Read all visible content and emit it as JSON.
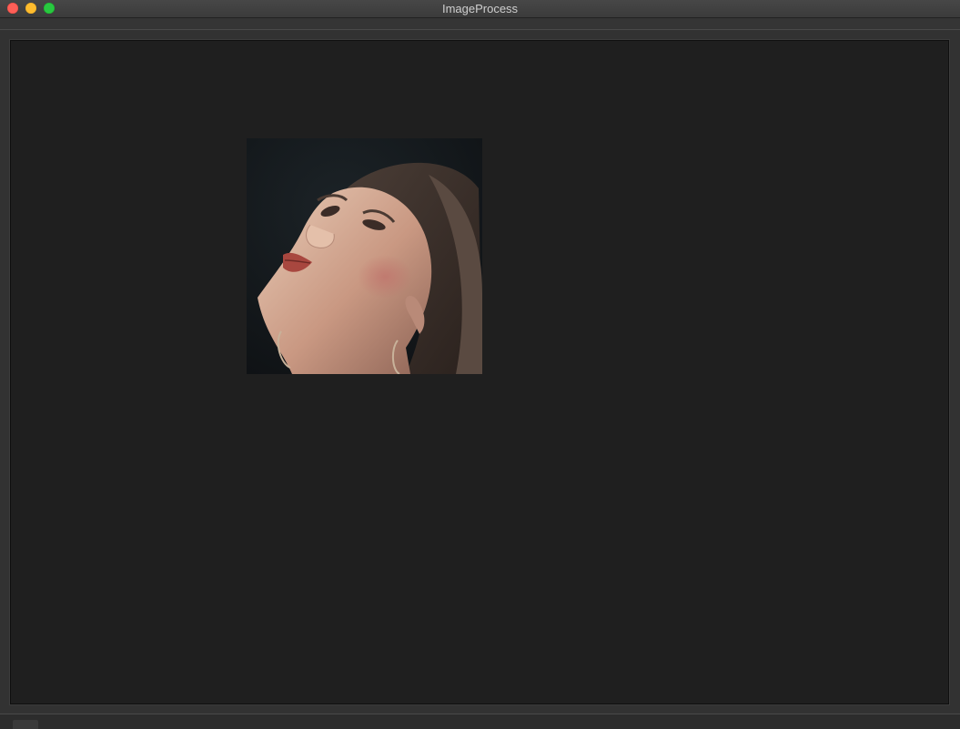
{
  "window": {
    "title": "ImageProcess"
  },
  "canvas": {
    "image_description_icon": "portrait-photo-icon"
  },
  "colors": {
    "canvas_background": "#1f1f1f",
    "window_chrome": "#323232",
    "close": "#ff5f57",
    "minimize": "#febc2e",
    "zoom": "#28c840"
  }
}
